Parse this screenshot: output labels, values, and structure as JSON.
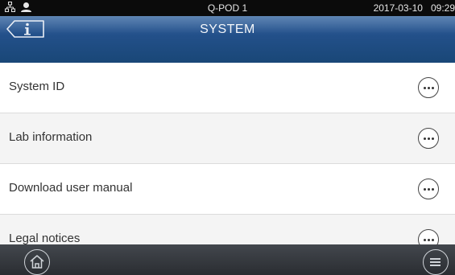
{
  "status_bar": {
    "device_name": "Q-POD 1",
    "date": "2017-03-10",
    "time": "09:29",
    "icons": [
      "network-icon",
      "user-icon"
    ]
  },
  "header": {
    "title": "SYSTEM",
    "back_icon": "info-back-icon"
  },
  "list": {
    "items": [
      {
        "label": "System ID"
      },
      {
        "label": "Lab information"
      },
      {
        "label": "Download user manual"
      },
      {
        "label": "Legal notices"
      }
    ]
  },
  "bottom_bar": {
    "icons": [
      "home-icon",
      "menu-icon"
    ]
  }
}
